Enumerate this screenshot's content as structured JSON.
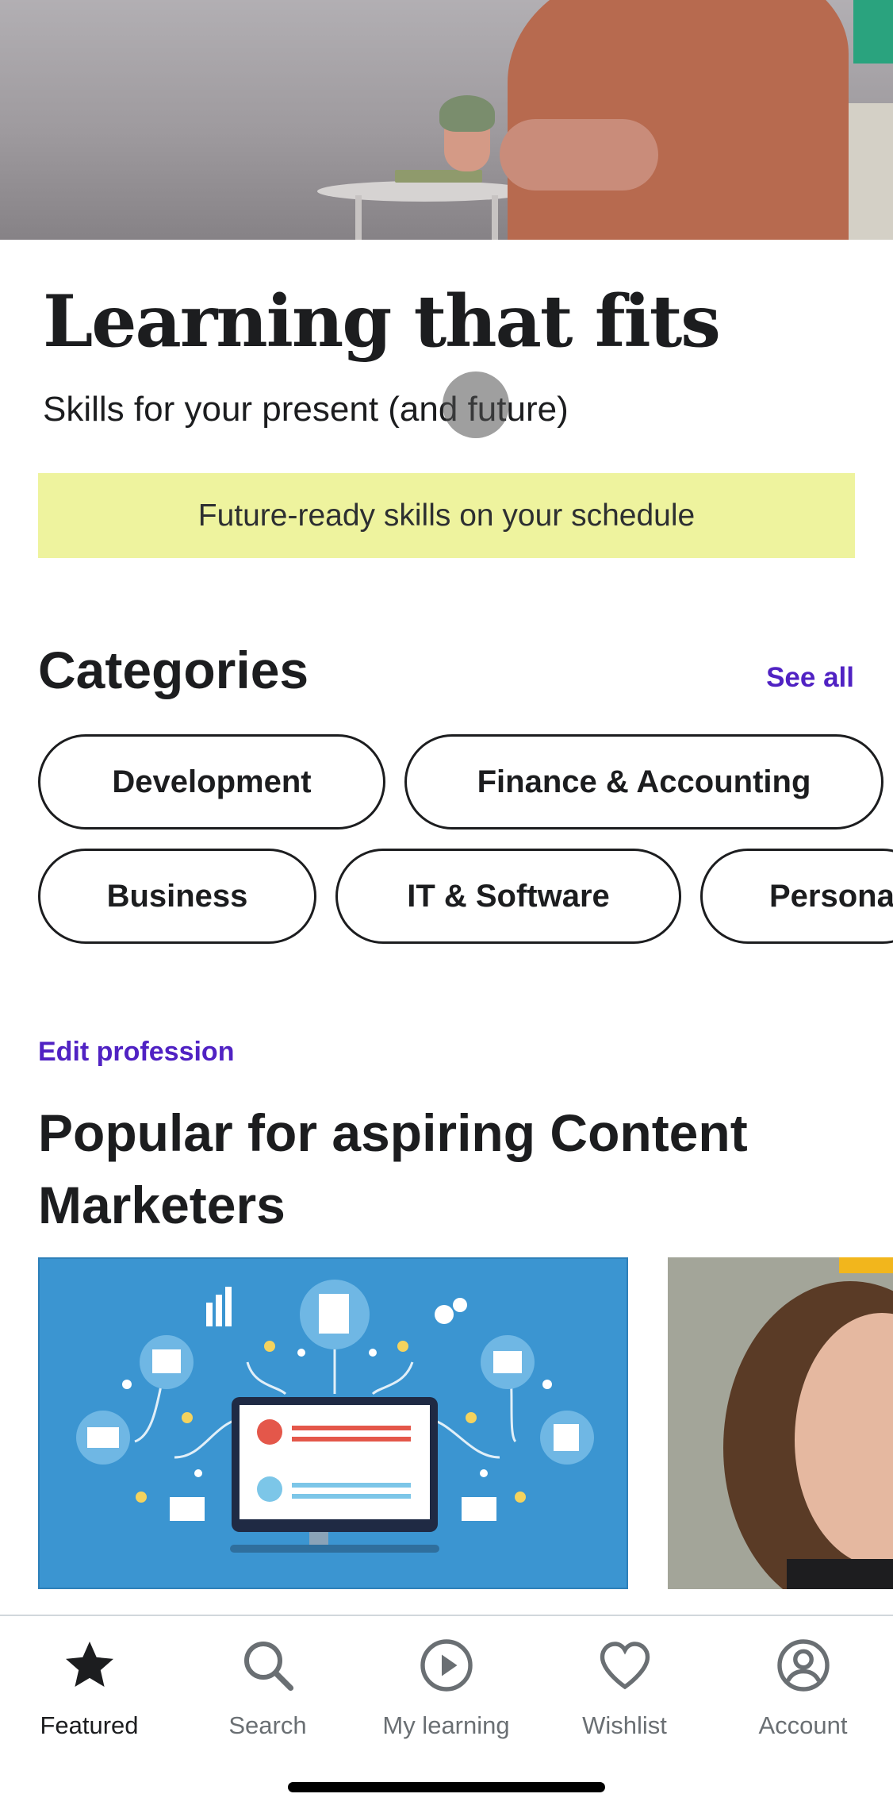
{
  "hero": {
    "title": "Learning that fits",
    "subtitle": "Skills for your present (and future)"
  },
  "banner": {
    "text": "Future-ready skills on your schedule"
  },
  "categories": {
    "title": "Categories",
    "see_all": "See all",
    "items": [
      "Development",
      "Finance & Accounting",
      "Business",
      "IT & Software",
      "Persona"
    ]
  },
  "popular": {
    "edit_profession": "Edit profession",
    "title": "Popular for aspiring Content Marketers"
  },
  "tabbar": {
    "items": [
      {
        "label": "Featured",
        "icon": "star-icon",
        "active": true
      },
      {
        "label": "Search",
        "icon": "search-icon",
        "active": false
      },
      {
        "label": "My learning",
        "icon": "play-circle-icon",
        "active": false
      },
      {
        "label": "Wishlist",
        "icon": "heart-icon",
        "active": false
      },
      {
        "label": "Account",
        "icon": "account-icon",
        "active": false
      }
    ]
  },
  "colors": {
    "accent": "#5022c3",
    "banner_bg": "#eef39e",
    "text": "#1c1d1f",
    "muted": "#6a6f73"
  }
}
